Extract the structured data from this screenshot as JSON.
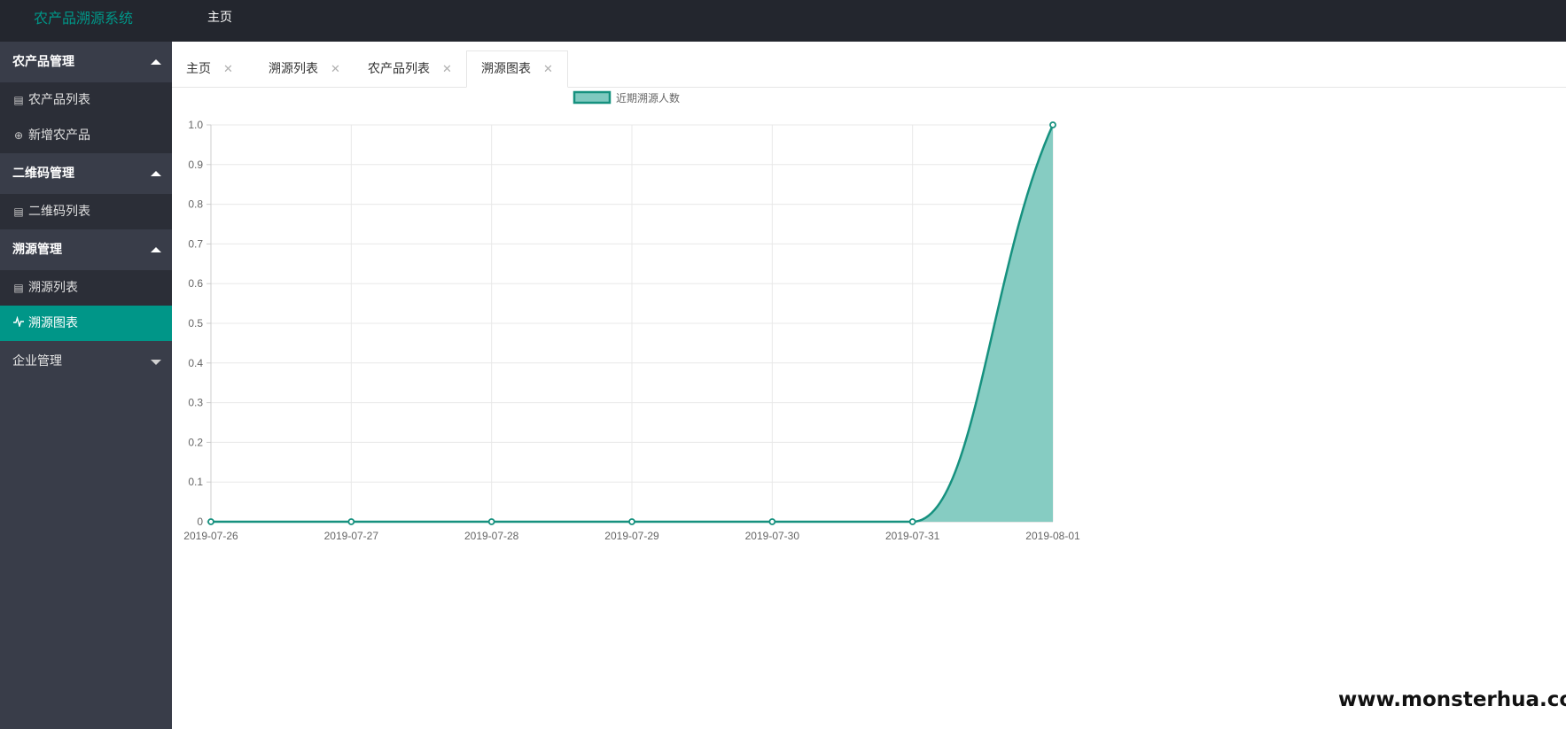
{
  "header": {
    "title": "农产品溯源系统",
    "nav_home": "主页"
  },
  "sidebar": {
    "groups": [
      {
        "label": "农产品管理",
        "items": [
          {
            "label": "农产品列表",
            "icon": "document-icon"
          },
          {
            "label": "新增农产品",
            "icon": "plus-circle-icon"
          }
        ]
      },
      {
        "label": "二维码管理",
        "items": [
          {
            "label": "二维码列表",
            "icon": "document-icon"
          }
        ]
      },
      {
        "label": "溯源管理",
        "items": [
          {
            "label": "溯源列表",
            "icon": "document-icon"
          },
          {
            "label": "溯源图表",
            "icon": "pulse-icon",
            "active": true
          }
        ]
      },
      {
        "label": "企业管理",
        "items": []
      }
    ]
  },
  "tabs": [
    {
      "label": "主页"
    },
    {
      "label": "溯源列表"
    },
    {
      "label": "农产品列表"
    },
    {
      "label": "溯源图表",
      "active": true
    }
  ],
  "chart_data": {
    "type": "area",
    "x": [
      "2019-07-26",
      "2019-07-27",
      "2019-07-28",
      "2019-07-29",
      "2019-07-30",
      "2019-07-31",
      "2019-08-01"
    ],
    "series": [
      {
        "name": "近期溯源人数",
        "values": [
          0,
          0,
          0,
          0,
          0,
          0,
          1
        ]
      }
    ],
    "ylim": [
      0,
      1.0
    ],
    "yticks": [
      "0",
      "0.1",
      "0.2",
      "0.3",
      "0.4",
      "0.5",
      "0.6",
      "0.7",
      "0.8",
      "0.9",
      "1.0"
    ],
    "grid": true,
    "legend": "top-center",
    "line_color": "#16917f",
    "fill_color": "#7fc9bf"
  },
  "watermark": "www.monsterhua.com",
  "colors": {
    "accent": "#009688",
    "topbar": "#23262e",
    "sidebar": "#393d49"
  }
}
